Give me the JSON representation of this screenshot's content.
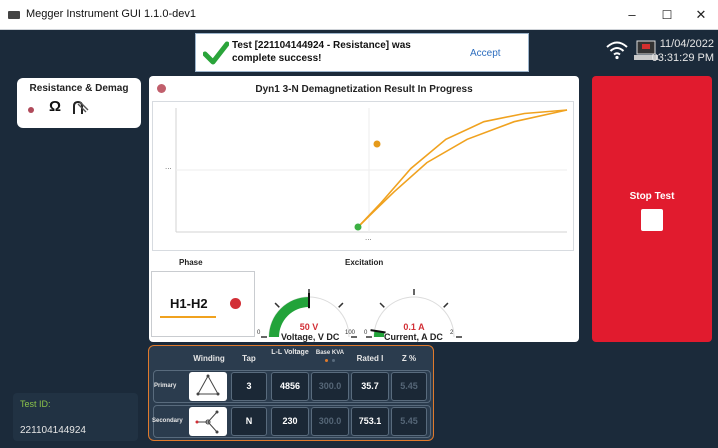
{
  "window": {
    "title": "Megger Instrument GUI 1.1.0-dev1",
    "minimize": "–",
    "maximize": "☐",
    "close": "✕"
  },
  "toast": {
    "message": "Test [221104144924 - Resistance] was complete success!",
    "accept_label": "Accept",
    "status": "success"
  },
  "status_bar": {
    "date": "11/04/2022",
    "time": "03:31:29 PM",
    "wifi": "wifi-icon",
    "device": "laptop-icon"
  },
  "test_type_tab": {
    "label": "Resistance & Demag",
    "icons": [
      "omega-icon",
      "demag-icon"
    ]
  },
  "chart_panel": {
    "title": "Dyn1 3-N Demagnetization Result In Progress",
    "x_label": "...",
    "y_label": "...",
    "phase_label": "Phase",
    "excitation_label": "Excitation"
  },
  "chart_data": {
    "type": "line",
    "title": "Dyn1 3-N Demagnetization Result In Progress",
    "xlabel": "...",
    "ylabel": "...",
    "series": [
      {
        "values": [
          0.0,
          0.1,
          0.3,
          0.55,
          0.75,
          0.9,
          1.0
        ]
      },
      {
        "values": [
          0.0,
          0.2,
          0.5,
          0.75,
          0.9,
          0.97,
          1.0
        ]
      }
    ],
    "points": [
      {
        "label": "start",
        "color": "#3cb043"
      },
      {
        "label": "current",
        "color": "#f0a21f"
      }
    ],
    "colors": {
      "line": "#f0a21f"
    }
  },
  "phase": {
    "value": "H1-H2",
    "indicator_color": "#d22f36"
  },
  "gauges": [
    {
      "name": "voltage",
      "value": "50 V",
      "unit_label": "Voltage, V DC",
      "min_label": "0",
      "max_label": "100",
      "fraction": 0.5,
      "fill_color": "#22a33a"
    },
    {
      "name": "current",
      "value": "0.1 A",
      "unit_label": "Current, A DC",
      "min_label": "0",
      "max_label": "2",
      "fraction": 0.05,
      "fill_color": "#22a33a"
    }
  ],
  "stop_button": {
    "label": "Stop Test"
  },
  "test_id": {
    "label": "Test ID:",
    "value": "221104144924"
  },
  "winding_table": {
    "headers": {
      "winding": "Winding",
      "tap": "Tap",
      "voltage": "L-L Voltage",
      "kva": "Base KVA",
      "rated": "Rated I",
      "z": "Z %"
    },
    "rows": [
      {
        "name": "Primary",
        "symbol": "delta-icon",
        "tap": "3",
        "voltage": "4856",
        "kva": "300.0",
        "rated": "35.7",
        "z": "5.45"
      },
      {
        "name": "Secondary",
        "symbol": "wye-icon",
        "tap": "N",
        "voltage": "230",
        "kva": "300.0",
        "rated": "753.1",
        "z": "5.45"
      }
    ]
  }
}
